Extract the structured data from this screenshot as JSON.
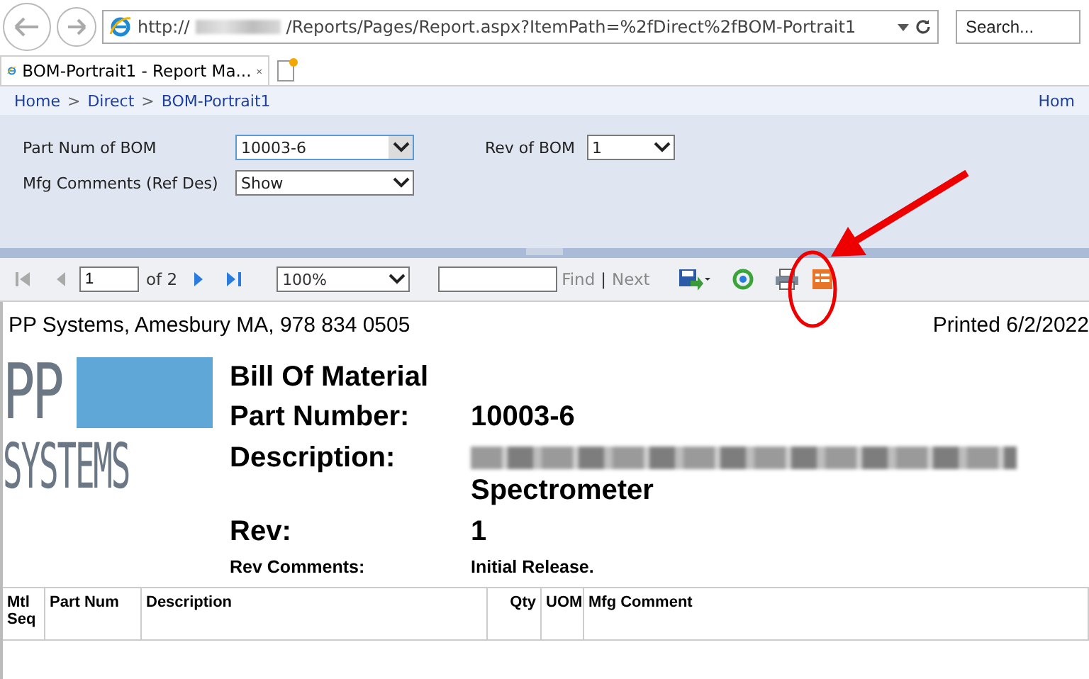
{
  "browser": {
    "url_prefix": "http://",
    "url_suffix": "/Reports/Pages/Report.aspx?ItemPath=%2fDirect%2fBOM-Portrait1",
    "search_placeholder": "Search...",
    "tabs": [
      {
        "label": "BOM-Portrait1 - Report Ma...",
        "selected": true
      }
    ]
  },
  "breadcrumb": {
    "items": [
      "Home",
      "Direct",
      "BOM-Portrait1"
    ],
    "separator": ">",
    "right_link": "Hom"
  },
  "parameters": [
    {
      "label": "Part Num of BOM",
      "value": "10003-6",
      "focused": true
    },
    {
      "label": "Rev of BOM",
      "value": "1",
      "focused": false
    },
    {
      "label": "Mfg Comments (Ref Des)",
      "value": "Show",
      "focused": false
    }
  ],
  "toolbar": {
    "page": "1",
    "of_pages": "of 2",
    "zoom": "100%",
    "find": "Find",
    "separator": "|",
    "next": "Next"
  },
  "report": {
    "header_left": "PP Systems, Amesbury MA, 978 834 0505",
    "header_right": "Printed 6/2/2022",
    "logo": {
      "line1": "PP",
      "line2": "SYSTEMS"
    },
    "title": "Bill Of Material",
    "fields": [
      {
        "label": "Part Number:",
        "value": "10003-6"
      },
      {
        "label": "Description:",
        "value": "Spectrometer",
        "redacted": true
      },
      {
        "label": "Rev:",
        "value": "1"
      }
    ],
    "rev_comments_label": "Rev Comments:",
    "rev_comments": "Initial Release.",
    "columns": [
      "Mtl Seq",
      "Part Num",
      "Description",
      "Qty",
      "UOM",
      "Mfg Comment"
    ]
  }
}
